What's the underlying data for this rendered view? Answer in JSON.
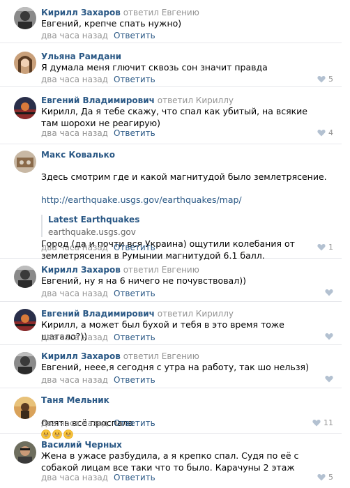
{
  "comments": [
    {
      "author": "Кирилл Захаров",
      "replied_to": "ответил Евгению",
      "text": "Евгений, крепче спать нужно)",
      "date": "два часа назад",
      "reply_label": "Ответить",
      "likes": "",
      "avatar": "avatar-kirill"
    },
    {
      "author": "Ульяна Рамдани",
      "replied_to": "",
      "text": "Я думала меня глючит сквозь сон значит правда",
      "date": "два часа назад",
      "reply_label": "Ответить",
      "likes": "5",
      "avatar": "avatar-ulyana"
    },
    {
      "author": "Евгений Владимирович",
      "replied_to": "ответил Кириллу",
      "text": "Кирилл, Да я тебе скажу, что спал как убитый, на всякие там шорохи не реагирую)",
      "date": "два часа назад",
      "reply_label": "Ответить",
      "likes": "4",
      "avatar": "avatar-evgeniy"
    },
    {
      "author": "Макс Ковалько",
      "replied_to": "",
      "text_line1": "Здесь смотрим где и какой магнитудой было землетрясение.",
      "text_link": "http://earthquake.usgs.gov/earthquakes/map/",
      "text_para2": "Город (да и почти вся Украина) ощутили колебания от землетрясения в Румынии магнитудой 6.1 балл.",
      "snippet_title": "Latest Earthquakes",
      "snippet_domain": "earthquake.usgs.gov",
      "date": "два часа назад",
      "reply_label": "Ответить",
      "likes": "1",
      "avatar": "avatar-maks"
    },
    {
      "author": "Кирилл Захаров",
      "replied_to": "ответил Евгению",
      "text": "Евгений, ну я на 6 ничего не почувствовал))",
      "date": "два часа назад",
      "reply_label": "Ответить",
      "likes": "",
      "avatar": "avatar-kirill"
    },
    {
      "author": "Евгений Владимирович",
      "replied_to": "ответил Кириллу",
      "text": "Кирилл, а может был бухой и тебя в это время тоже шатало?))",
      "date": "два часа назад",
      "reply_label": "Ответить",
      "likes": "",
      "avatar": "avatar-evgeniy"
    },
    {
      "author": "Кирилл Захаров",
      "replied_to": "ответил Евгению",
      "text": "Евгений, неее,я сегодня с утра на работу, так шо нельзя)",
      "date": "два часа назад",
      "reply_label": "Ответить",
      "likes": "",
      "avatar": "avatar-kirill"
    },
    {
      "author": "Таня Мельник",
      "replied_to": "",
      "text": "Опять всё проспала",
      "emoji": [
        "grinning-face-emoji",
        "grinning-face-emoji",
        "grinning-face-emoji"
      ],
      "date": "два часа назад",
      "reply_label": "Ответить",
      "likes": "11",
      "avatar": "avatar-tanya"
    },
    {
      "author": "Василий Черных",
      "replied_to": "",
      "text": "Жена в ужасе разбудила, а я крепко спал. Судя по её с собакой лицам все таки что то было. Карачуны 2 этаж",
      "date": "два часа назад",
      "reply_label": "Ответить",
      "likes": "5",
      "avatar": "avatar-vasiliy"
    }
  ],
  "colors": {
    "link": "#2a5885",
    "muted": "#939393",
    "divider": "#e7e8ec",
    "like_icon": "#b3c1d1"
  }
}
